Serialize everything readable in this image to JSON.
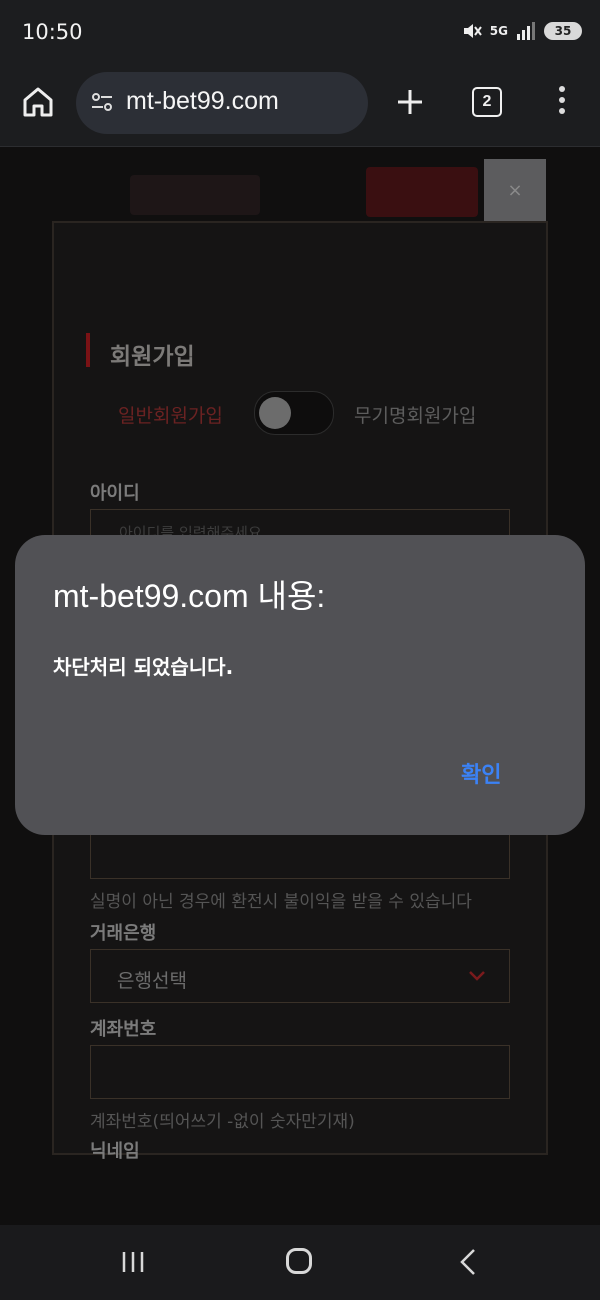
{
  "status_bar": {
    "time": "10:50",
    "network": "5G",
    "battery": "35"
  },
  "browser": {
    "url": "mt-bet99.com",
    "tab_count": "2"
  },
  "page": {
    "close_label": "×",
    "title": "회원가입",
    "type_left": "일반회원가입",
    "type_right": "무기명회원가입",
    "label_id": "아이디",
    "id_placeholder": "아이디를 입력해주세요",
    "name_hint": "실명이 아닌 경우에 환전시 불이익을 받을 수 있습니다",
    "label_bank": "거래은행",
    "bank_select": "은행선택",
    "label_account": "계좌번호",
    "account_hint": "계좌번호(띄어쓰기 -없이 숫자만기재)",
    "label_nickname": "닉네임"
  },
  "dialog": {
    "title": "mt-bet99.com 내용:",
    "message": "차단처리 되었습니다.",
    "confirm": "확인"
  },
  "colors": {
    "dialog_bg": "#515155",
    "confirm": "#3b82f6",
    "browser_bg": "#1c1d1f"
  }
}
